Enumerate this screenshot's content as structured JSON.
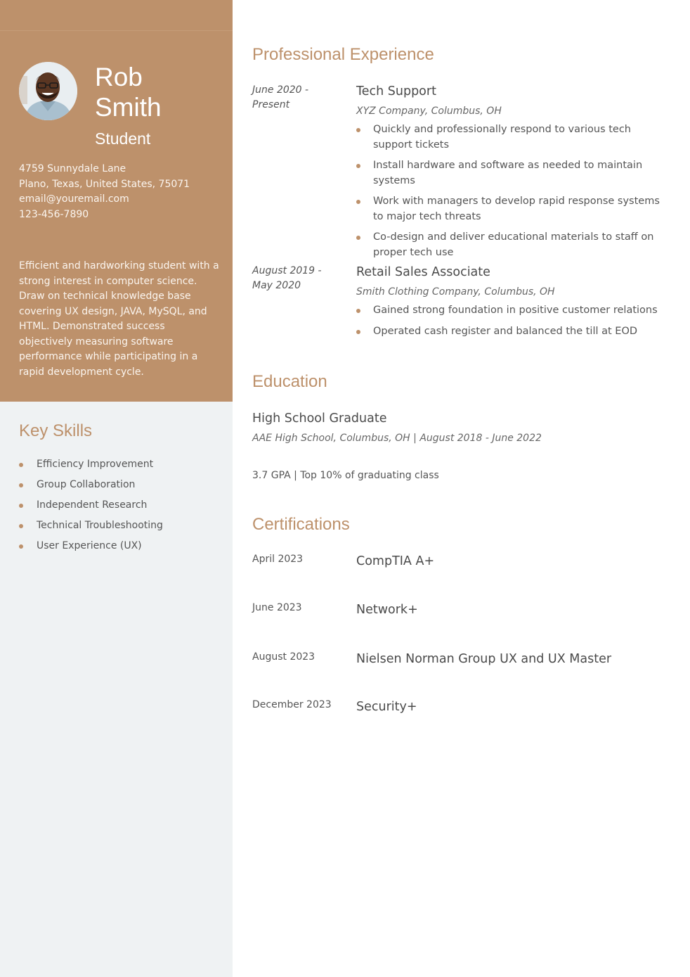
{
  "colors": {
    "accent": "#bd916b",
    "sidebar_bottom": "#eff2f3",
    "text": "#4a4a4a"
  },
  "profile": {
    "first_name": "Rob",
    "last_name": "Smith",
    "role": "Student",
    "photo_alt": "profile-photo"
  },
  "contact": {
    "address_line1": "4759 Sunnydale Lane",
    "address_line2": "Plano, Texas, United States, 75071",
    "email": "email@youremail.com",
    "phone": "123-456-7890"
  },
  "summary": "Efficient and hardworking student with a strong interest in computer science. Draw on technical knowledge base covering UX design, JAVA, MySQL, and HTML. Demonstrated success objectively measuring software performance while participating in a rapid development cycle.",
  "skills": {
    "title": "Key Skills",
    "items": [
      "Efficiency Improvement",
      "Group Collaboration",
      "Independent Research",
      "Technical Troubleshooting",
      "User Experience (UX)"
    ]
  },
  "experience": {
    "title": "Professional Experience",
    "jobs": [
      {
        "dates": "June 2020 - Present",
        "title": "Tech Support",
        "company": "XYZ Company, Columbus, OH",
        "bullets": [
          "Quickly and professionally respond to various tech support tickets",
          "Install hardware and software as needed to maintain systems",
          "Work with managers to develop rapid response systems to major tech threats",
          "Co-design and deliver educational materials to staff on proper tech use"
        ]
      },
      {
        "dates": "August 2019 - May 2020",
        "title": "Retail Sales Associate",
        "company": "Smith Clothing Company, Columbus, OH",
        "bullets": [
          "Gained strong foundation in positive customer relations",
          "Operated cash register and balanced the till at EOD"
        ]
      }
    ]
  },
  "education": {
    "title": "Education",
    "degree": "High School Graduate",
    "meta": "AAE High School, Columbus, OH | August 2018 - June 2022",
    "detail": "3.7 GPA | Top 10% of graduating class"
  },
  "certifications": {
    "title": "Certifications",
    "items": [
      {
        "date": "April 2023",
        "name": "CompTIA A+"
      },
      {
        "date": "June 2023",
        "name": "Network+"
      },
      {
        "date": "August 2023",
        "name": "Nielsen Norman Group UX and UX Master"
      },
      {
        "date": "December 2023",
        "name": "Security+"
      }
    ]
  }
}
